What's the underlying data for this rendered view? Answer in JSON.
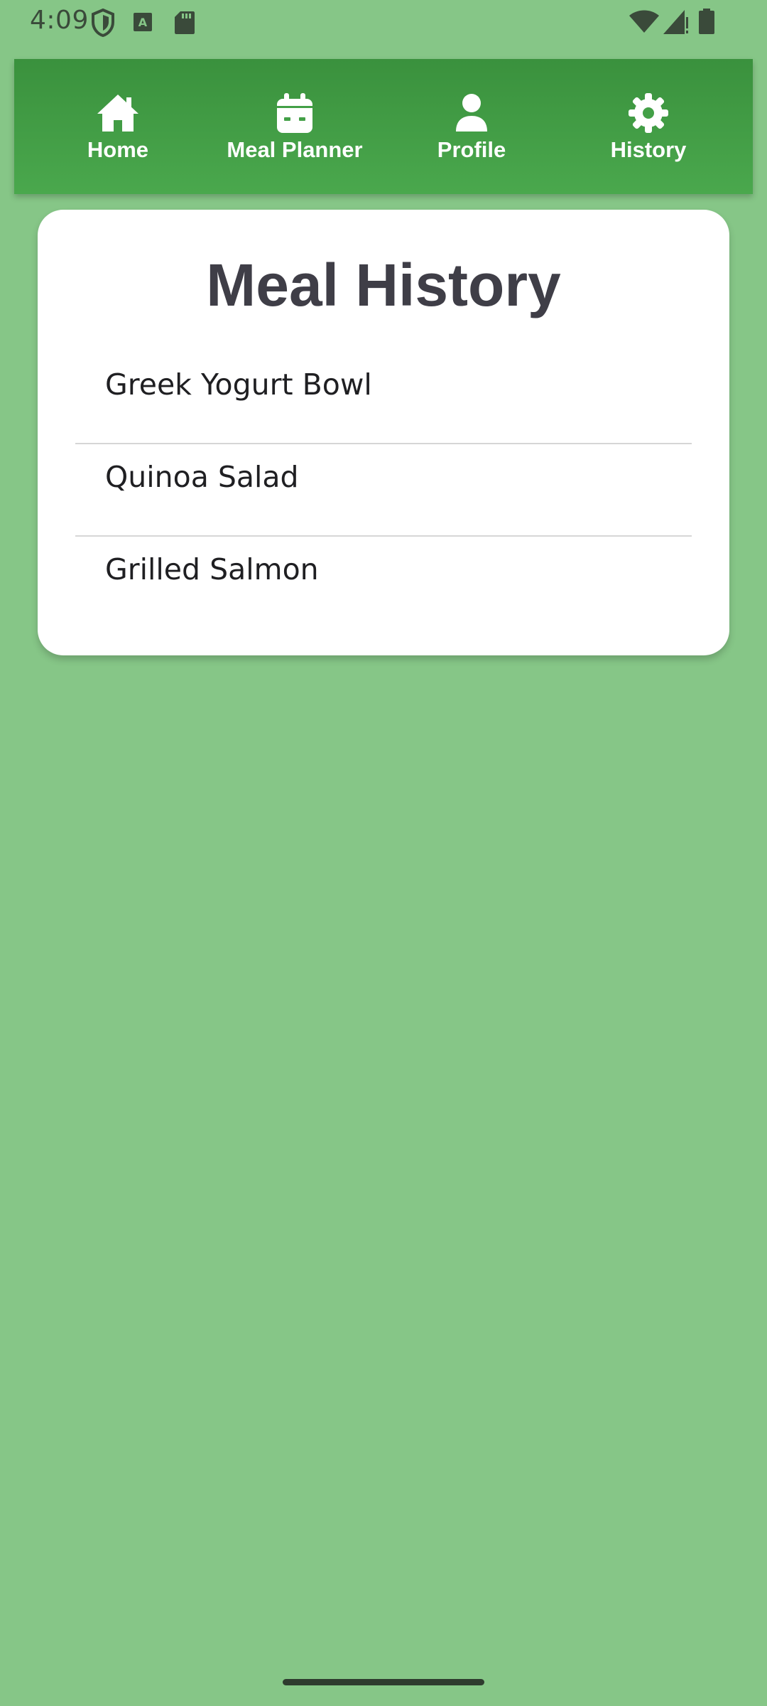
{
  "status_bar": {
    "time": "4:09",
    "left_icons": [
      "shield-icon",
      "text-a-icon",
      "sd-card-icon"
    ],
    "right_icons": [
      "wifi-icon",
      "signal-icon",
      "battery-icon"
    ]
  },
  "nav": {
    "items": [
      {
        "label": "Home",
        "icon": "home-icon"
      },
      {
        "label": "Meal Planner",
        "icon": "calendar-icon"
      },
      {
        "label": "Profile",
        "icon": "person-icon"
      },
      {
        "label": "History",
        "icon": "gear-icon"
      }
    ]
  },
  "main": {
    "title": "Meal History",
    "meals": [
      "Greek Yogurt Bowl",
      "Quinoa Salad",
      "Grilled Salmon"
    ]
  },
  "colors": {
    "background": "#86c687",
    "nav_bar": "#43a047",
    "title_text": "#3f3e47",
    "card": "#ffffff"
  }
}
